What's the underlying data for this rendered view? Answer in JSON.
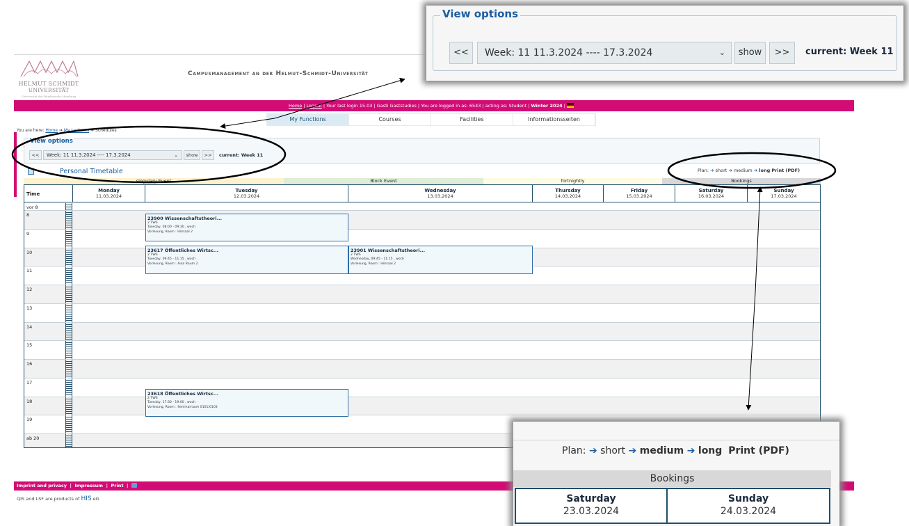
{
  "header": {
    "logo_line1": "HELMUT SCHMIDT",
    "logo_line2": "UNIVERSITÄT",
    "logo_line3": "Universität der Bundeswehr Hamburg",
    "campus_title": "Campusmanagement an der Helmut-Schmidt-Universität"
  },
  "topbar": {
    "home": "Home",
    "logout": "Logout",
    "last_login": "Your last login 15.03",
    "user": "Gasti Gaststudies",
    "logged_in": "You are logged in as: 6543",
    "acting": "acting as: Student",
    "semester": "Winter 2024"
  },
  "nav": {
    "tabs": [
      "My Functions",
      "Courses",
      "Facilities",
      "Informationsseiten"
    ]
  },
  "breadcrumb": {
    "prefix": "You are here:",
    "home": "Home",
    "mid": "My Lectures",
    "current": "Schedules"
  },
  "view_options": {
    "legend": "View options",
    "prev": "<<",
    "next": ">>",
    "week_value": "Week: 11   11.3.2024 ---- 17.3.2024",
    "show": "show",
    "current": "current: Week 11"
  },
  "timetable": {
    "title": "Personal Timetable"
  },
  "plan": {
    "label": "Plan:",
    "short": "short",
    "medium": "medium",
    "long": "long",
    "pdf": "Print (PDF)"
  },
  "legend": {
    "singulary": "singulary Event",
    "block": "Block Event",
    "fortnightly": "fortnightly",
    "bookings": "Bookings",
    "colors": {
      "singulary": "#fcf2cf",
      "block": "#dfecd8",
      "fortnightly": "#fdfbe3",
      "bookings": "#d8d8d8"
    }
  },
  "columns": {
    "time": "Time",
    "days": [
      {
        "day": "Monday",
        "date": "11.03.2024"
      },
      {
        "day": "Tuesday",
        "date": "12.03.2024"
      },
      {
        "day": "Wednesday",
        "date": "13.03.2024"
      },
      {
        "day": "Thursday",
        "date": "14.03.2024"
      },
      {
        "day": "Friday",
        "date": "15.03.2024"
      },
      {
        "day": "Saturday",
        "date": "16.03.2024"
      },
      {
        "day": "Sunday",
        "date": "17.03.2024"
      }
    ]
  },
  "rows": [
    "vor 8",
    "8",
    "9",
    "10",
    "11",
    "12",
    "13",
    "14",
    "15",
    "16",
    "17",
    "18",
    "19",
    "ab 20"
  ],
  "events": [
    {
      "title": "23900 Wissenschaftstheori...",
      "sws": "2 TWS",
      "time": "Tuesday, 08:00 - 09:30 , woch",
      "room": "Vorlesung, Room : Hörsaal 2"
    },
    {
      "title": "23617 Öffentliches Wirtsc...",
      "sws": "2 TWS",
      "time": "Tuesday, 09:45 - 11:15 , woch",
      "room": "Vorlesung, Room : Aula Raum 2"
    },
    {
      "title": "23901 Wissenschaftstheori...",
      "sws": "2 TWS",
      "time": "Wednesday, 09:45 - 11:15 , woch",
      "room": "Vorlesung, Room : Hörsaal 2"
    },
    {
      "title": "23618 Öffentliches Wirtsc...",
      "sws": "2 TWS",
      "time": "Tuesday, 17:30 - 19:00 , woch",
      "room": "Vorlesung, Room : Seminarraum 0101/0103"
    }
  ],
  "footer": {
    "imprint": "Imprint and privacy",
    "impressum": "Impressum",
    "print": "Print",
    "products": "QIS and LSF are products of",
    "his": "HIS",
    "eg": "eG"
  },
  "zoom_bottom": {
    "bookings": "Bookings",
    "days": [
      {
        "day": "Saturday",
        "date": "23.03.2024"
      },
      {
        "day": "Sunday",
        "date": "24.03.2024"
      }
    ]
  },
  "icons": [
    "calendar-icon",
    "printer-icon",
    "flag-icon",
    "arrow-right-icon",
    "chevron-down-icon"
  ]
}
